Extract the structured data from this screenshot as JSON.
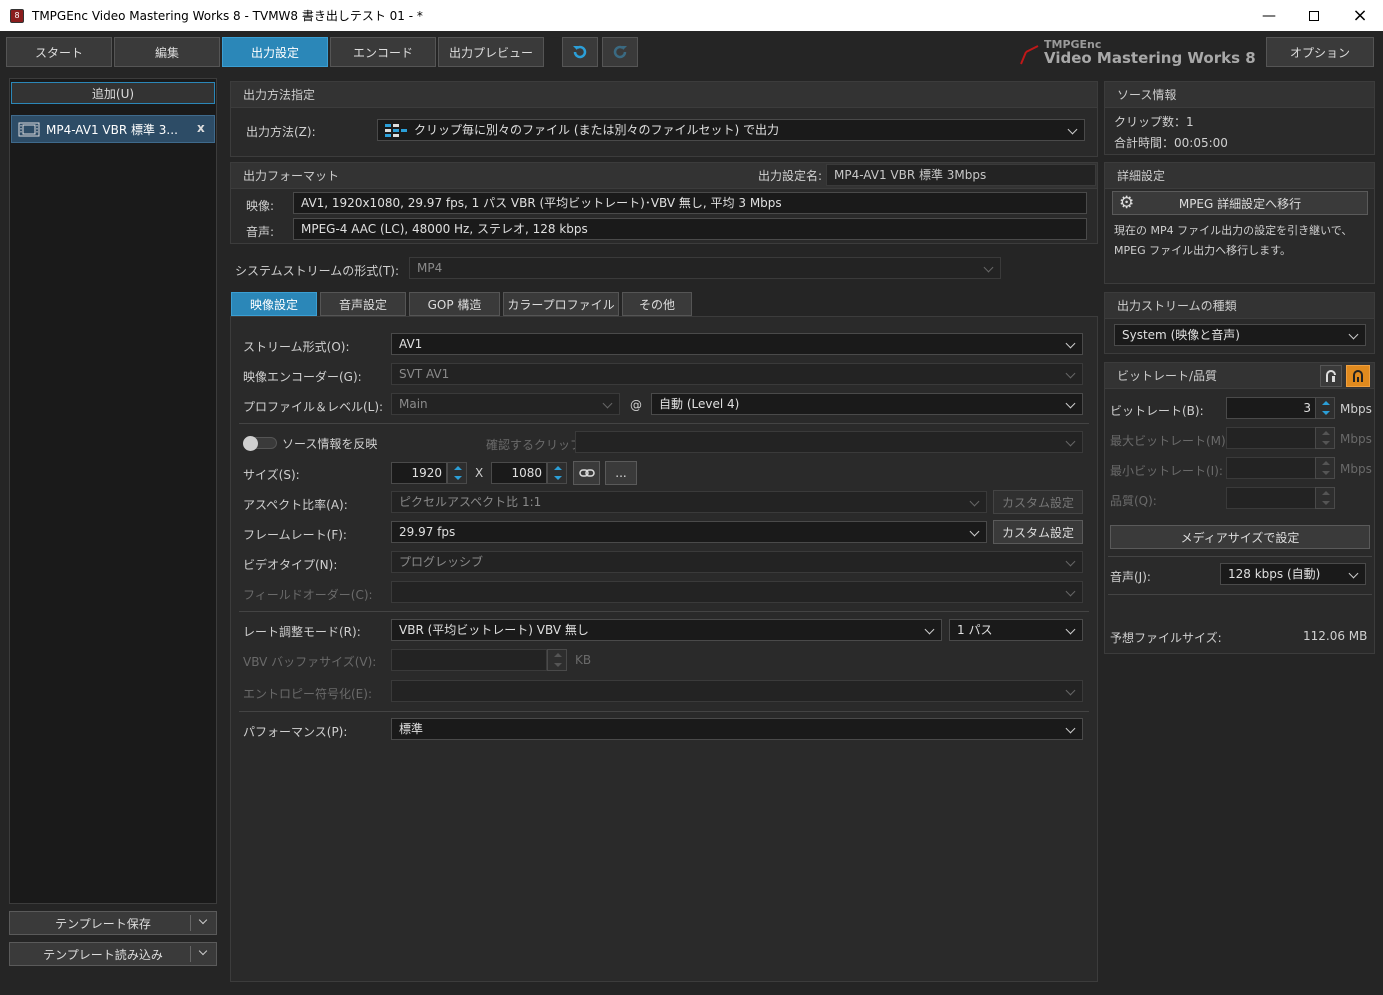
{
  "window": {
    "title": "TMPGEnc Video Mastering Works 8 - TVMW8 書き出しテスト 01 - *"
  },
  "main_tabs": [
    "スタート",
    "編集",
    "出力設定",
    "エンコード",
    "出力プレビュー"
  ],
  "active_tab": "出力設定",
  "brand": {
    "small": "TMPGEnc",
    "large": "Video Mastering Works 8"
  },
  "options_label": "オプション",
  "left": {
    "add_label": "追加(U)",
    "items": [
      {
        "label": "MP4-AV1 VBR 標準 3...",
        "remove": "x"
      }
    ],
    "save_template": "テンプレート保存",
    "load_template": "テンプレート読み込み"
  },
  "output_method": {
    "header": "出力方法指定",
    "label": "出力方法(Z):",
    "value": "クリップ毎に別々のファイル (または別々のファイルセット) で出力"
  },
  "output_format": {
    "header": "出力フォーマット",
    "name_label": "出力設定名:",
    "name_value": "MP4-AV1 VBR 標準 3Mbps",
    "video_label": "映像:",
    "video_value": "AV1, 1920x1080, 29.97 fps, 1 パス VBR (平均ビットレート)･VBV 無し, 平均 3 Mbps",
    "audio_label": "音声:",
    "audio_value": "MPEG-4 AAC (LC), 48000 Hz, ステレオ, 128 kbps"
  },
  "system_stream": {
    "label": "システムストリームの形式(T):",
    "value": "MP4"
  },
  "sub_tabs": [
    "映像設定",
    "音声設定",
    "GOP 構造",
    "カラープロファイル",
    "その他"
  ],
  "active_sub_tab": "映像設定",
  "video": {
    "stream_label": "ストリーム形式(O):",
    "stream_value": "AV1",
    "encoder_label": "映像エンコーダー(G):",
    "encoder_value": "SVT AV1",
    "profile_label": "プロファイル＆レベル(L):",
    "profile_value": "Main",
    "at": "@",
    "level_value": "自動 (Level 4)",
    "source_toggle_label": "ソース情報を反映",
    "confirm_clip_label": "確認するクリップ:",
    "size_label": "サイズ(S):",
    "width": "1920",
    "x": "X",
    "height": "1080",
    "more": "...",
    "aspect_label": "アスペクト比率(A):",
    "aspect_value": "ピクセルアスペクト比 1:1",
    "custom1": "カスタム設定",
    "framerate_label": "フレームレート(F):",
    "framerate_value": "29.97 fps",
    "custom2": "カスタム設定",
    "videotype_label": "ビデオタイプ(N):",
    "videotype_value": "プログレッシブ",
    "fieldorder_label": "フィールドオーダー(C):",
    "rate_label": "レート調整モード(R):",
    "rate_value": "VBR (平均ビットレート) VBV 無し",
    "pass_value": "1 パス",
    "vbv_label": "VBV バッファサイズ(V):",
    "vbv_unit": "KB",
    "entropy_label": "エントロピー符号化(E):",
    "performance_label": "パフォーマンス(P):",
    "performance_value": "標準"
  },
  "source_info": {
    "header": "ソース情報",
    "clips": "クリップ数：1",
    "duration": "合計時間：00:05:00"
  },
  "detail": {
    "header": "詳細設定",
    "mpeg_btn": "MPEG 詳細設定へ移行",
    "desc1": "現在の MP4 ファイル出力の設定を引き継いで、",
    "desc2": "MPEG ファイル出力へ移行します。"
  },
  "stream_type": {
    "header": "出力ストリームの種類",
    "value": "System (映像と音声)"
  },
  "bitrate": {
    "header": "ビットレート/品質",
    "bitrate_label": "ビットレート(B):",
    "bitrate_value": "3",
    "unit": "Mbps",
    "max_label": "最大ビットレート(M):",
    "min_label": "最小ビットレート(I):",
    "quality_label": "品質(Q):",
    "media_btn": "メディアサイズで設定",
    "audio_label": "音声(J):",
    "audio_value": "128 kbps (自動)",
    "est_label": "予想ファイルサイズ:",
    "est_value": "112.06 MB"
  },
  "colors": {
    "accent": "#2b87b8",
    "orange": "#e08a1e"
  }
}
